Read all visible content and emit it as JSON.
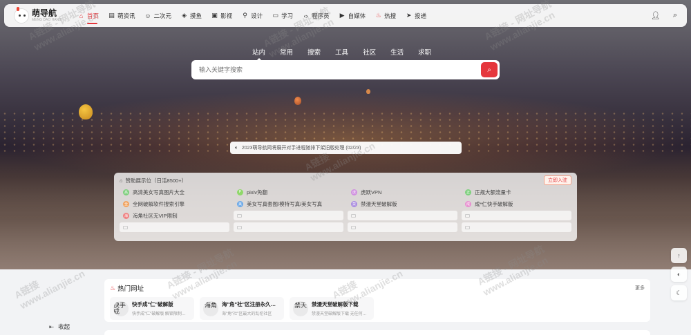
{
  "brand": {
    "title": "萌导航",
    "subtitle": "MENG DAO HANG"
  },
  "nav": [
    {
      "label": "首页",
      "icon": "home-icon",
      "glyph": "⌂",
      "active": true
    },
    {
      "label": "萌资讯",
      "icon": "news-icon",
      "glyph": "▤"
    },
    {
      "label": "二次元",
      "icon": "smile-icon",
      "glyph": "☺"
    },
    {
      "label": "摸鱼",
      "icon": "tag-icon",
      "glyph": "◈"
    },
    {
      "label": "影视",
      "icon": "film-icon",
      "glyph": "▣"
    },
    {
      "label": "设计",
      "icon": "pin-icon",
      "glyph": "⚲"
    },
    {
      "label": "学习",
      "icon": "monitor-icon",
      "glyph": "▭"
    },
    {
      "label": "程序员",
      "icon": "code-icon",
      "glyph": "‹›"
    },
    {
      "label": "自媒体",
      "icon": "video-icon",
      "glyph": "▶"
    },
    {
      "label": "热搜",
      "icon": "fire-icon",
      "glyph": "♨",
      "hot": true
    },
    {
      "label": "投递",
      "icon": "send-icon",
      "glyph": "➤"
    }
  ],
  "search": {
    "tabs": [
      "站内",
      "常用",
      "搜索",
      "工具",
      "社区",
      "生活",
      "求职"
    ],
    "active_tab": 0,
    "placeholder": "输入关键字搜索"
  },
  "notice": {
    "text": "2023萌导航网将展开对手进程随排下架旧版处理 (02/23)"
  },
  "sponsor": {
    "title": "赞助展示位（日活8500+）",
    "apply_label": "立即入驻",
    "items": [
      {
        "label": "高清美女写真图片大全",
        "color": "#7ed07e",
        "initial": "高"
      },
      {
        "label": "pixiv免翻",
        "color": "#8fd86a",
        "initial": "P"
      },
      {
        "label": "虎跃VPN",
        "color": "#d08fe0",
        "initial": "虎"
      },
      {
        "label": "正规大额流量卡",
        "color": "#7ed07e",
        "initial": "正"
      },
      {
        "label": "全网破解软件搜索引擎",
        "color": "#f2a35e",
        "initial": "全"
      },
      {
        "label": "美女写真套图/模特写真/美女写真",
        "color": "#6aa8e8",
        "initial": "美"
      },
      {
        "label": "禁漫天堂破解版",
        "color": "#a98be0",
        "initial": "禁"
      },
      {
        "label": "成*仁快手破解版",
        "color": "#e88fd0",
        "initial": "成"
      },
      {
        "label": "海角社区无VIP限制",
        "color": "#f08080",
        "initial": "海"
      }
    ],
    "empty_slots": 7
  },
  "hot": {
    "title": "热门网址",
    "more_label": "更多",
    "items": [
      {
        "thumb": "快手成",
        "name": "快手成\"仁\"破解版",
        "desc": "快手成\"仁\"破解版 解锁限制…"
      },
      {
        "thumb": "海角",
        "name": "海\"角\"社\"区注册永久免费",
        "desc": "海\"角\"社\"区最大的乱伦社区"
      },
      {
        "thumb": "禁天",
        "name": "禁漫天堂破解版下载",
        "desc": "禁漫天堂破解版下载 无任何…"
      }
    ]
  },
  "sidebar": {
    "collapse_label": "收起"
  },
  "watermark": {
    "line1": "A链接 - 网址导航",
    "line2": "www.alianjie.cn",
    "short": "A链接",
    "url": "www.alianjie.cn"
  }
}
